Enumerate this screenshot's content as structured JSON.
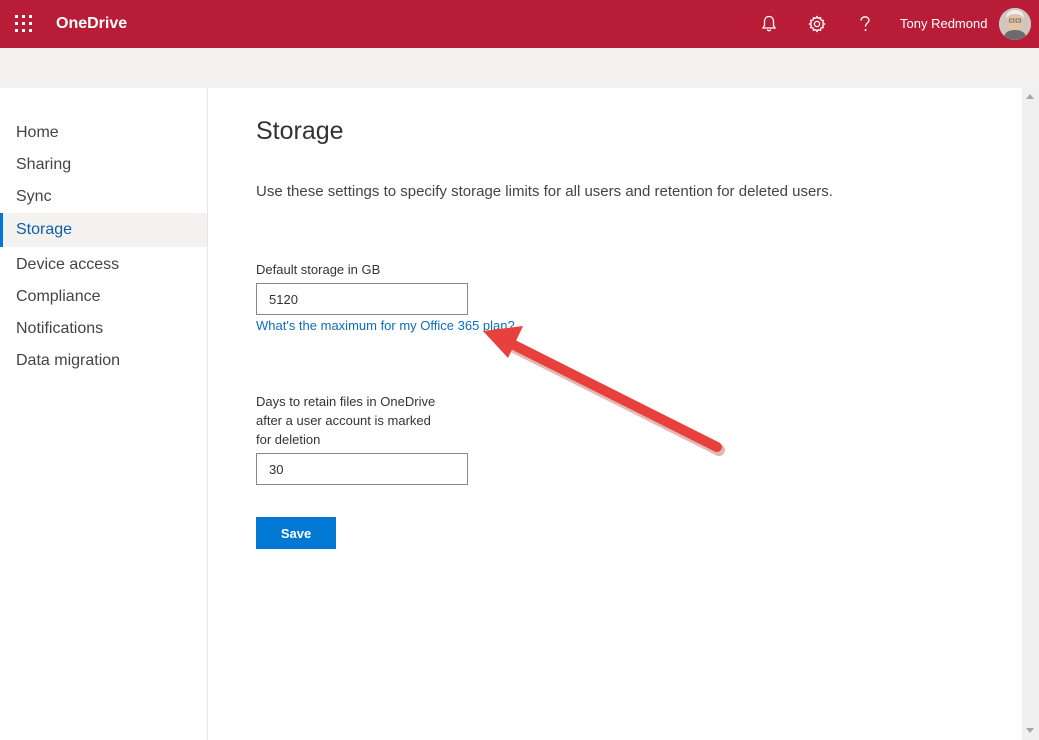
{
  "header": {
    "app_name": "OneDrive",
    "user_name": "Tony Redmond",
    "bar_color": "#b91c37",
    "icons": [
      "app-launcher-icon",
      "bell-icon",
      "gear-icon",
      "help-icon"
    ]
  },
  "sidebar": {
    "items": [
      {
        "label": "Home"
      },
      {
        "label": "Sharing"
      },
      {
        "label": "Sync"
      },
      {
        "label": "Storage",
        "active": true
      },
      {
        "label": "Device access"
      },
      {
        "label": "Compliance"
      },
      {
        "label": "Notifications"
      },
      {
        "label": "Data migration"
      }
    ]
  },
  "main": {
    "title": "Storage",
    "description": "Use these settings to specify storage limits for all users and retention for deleted users.",
    "default_storage": {
      "label": "Default storage in GB",
      "value": "5120",
      "help_link": "What's the maximum for my Office 365 plan?"
    },
    "retention": {
      "label_lines": [
        "Days to retain files in OneDrive",
        "after a user account is marked",
        "for deletion"
      ],
      "value": "30"
    },
    "save_label": "Save"
  },
  "annotation": {
    "type": "red-arrow",
    "color": "#e8413d"
  },
  "colors": {
    "accent": "#0078d4",
    "link": "#0f6cbd"
  }
}
